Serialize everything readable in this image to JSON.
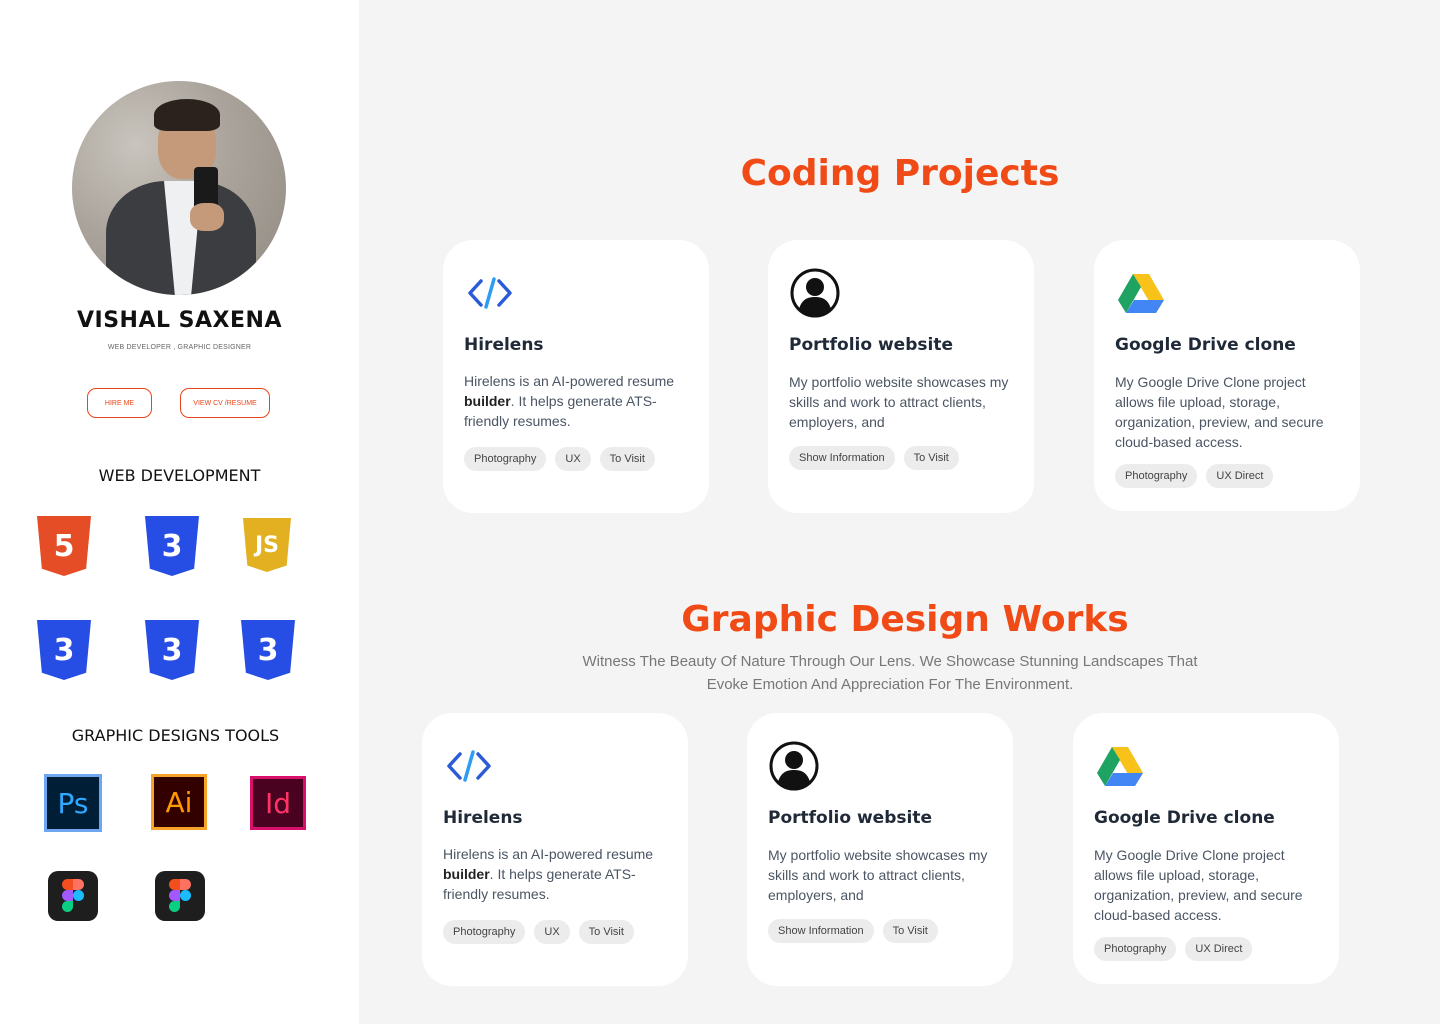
{
  "profile": {
    "name": "VISHAL SAXENA",
    "role": "WEB DEVELOPER , GRAPHIC DESIGNER",
    "hire_label": "HIRE ME",
    "cv_label": "VIEW CV /RESUME"
  },
  "skills": {
    "web_title": "WEB DEVELOPMENT",
    "web_icons": [
      "html5-icon",
      "css3-icon",
      "javascript-icon",
      "css3-icon",
      "css3-icon",
      "css3-icon"
    ],
    "graphic_title": "GRAPHIC DESIGNS TOOLS",
    "graphic_icons": [
      "photoshop-icon",
      "illustrator-icon",
      "indesign-icon",
      "figma-icon",
      "figma-icon"
    ],
    "tool_labels": {
      "ps": "Ps",
      "ai": "Ai",
      "id": "Id",
      "js": "JS"
    }
  },
  "coding": {
    "heading": "Coding Projects",
    "cards": [
      {
        "icon": "code-icon",
        "title": "Hirelens",
        "desc_pre": "Hirelens is an AI-powered resume ",
        "desc_bold": "builder",
        "desc_post": ". It helps generate ATS-friendly resumes.",
        "tags": [
          "Photography",
          "UX",
          "To Visit"
        ]
      },
      {
        "icon": "user-icon",
        "title": "Portfolio website",
        "desc": "My portfolio website showcases my skills and work to attract clients, employers, and",
        "tags": [
          "Show Information",
          "To Visit"
        ]
      },
      {
        "icon": "google-drive-icon",
        "title": "Google Drive clone",
        "desc": "My Google Drive Clone project allows file upload, storage, organization, preview, and secure cloud-based access.",
        "tags": [
          "Photography",
          "UX Direct"
        ]
      }
    ]
  },
  "graphic": {
    "heading": "Graphic Design Works",
    "subtitle": "Witness The Beauty Of Nature Through Our Lens. We Showcase Stunning Landscapes That Evoke Emotion And Appreciation For The Environment.",
    "cards": [
      {
        "icon": "code-icon",
        "title": "Hirelens",
        "desc_pre": "Hirelens is an AI-powered resume ",
        "desc_bold": "builder",
        "desc_post": ". It helps generate ATS-friendly resumes.",
        "tags": [
          "Photography",
          "UX",
          "To Visit"
        ]
      },
      {
        "icon": "user-icon",
        "title": "Portfolio website",
        "desc": "My portfolio website showcases my skills and work to attract clients, employers, and",
        "tags": [
          "Show Information",
          "To Visit"
        ]
      },
      {
        "icon": "google-drive-icon",
        "title": "Google Drive clone",
        "desc": "My Google Drive Clone project allows file upload, storage, organization, preview, and secure cloud-based access.",
        "tags": [
          "Photography",
          "UX Direct"
        ]
      }
    ]
  },
  "colors": {
    "accent": "#f04a16",
    "button_border": "#e8461a",
    "sidebar_bg": "#ffffff",
    "main_bg": "#f4f4f4",
    "tag_bg": "#ececec"
  }
}
